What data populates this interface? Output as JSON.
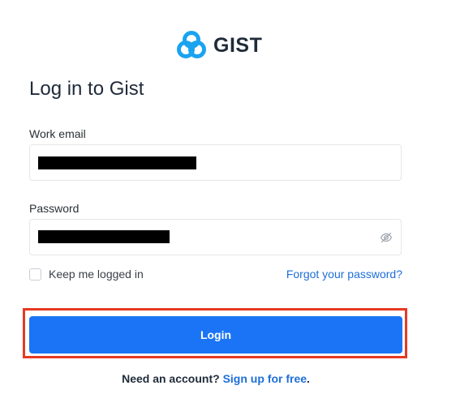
{
  "brand": {
    "name": "GIST",
    "logo_icon": "gist-trefoil-logo-icon",
    "logo_color": "#1aa3f0"
  },
  "title": "Log in to Gist",
  "form": {
    "email": {
      "label": "Work email",
      "value_redacted": true
    },
    "password": {
      "label": "Password",
      "value_redacted": true,
      "toggle_icon": "eye-off-icon"
    },
    "keep_logged_in": {
      "label": "Keep me logged in",
      "checked": false
    },
    "forgot_link": "Forgot your password?",
    "submit_label": "Login"
  },
  "signup": {
    "prompt": "Need an account?",
    "link": "Sign up for free",
    "suffix": "."
  },
  "colors": {
    "primary": "#1a74f5",
    "link": "#1d6fd8",
    "highlight_border": "#e53a23"
  }
}
